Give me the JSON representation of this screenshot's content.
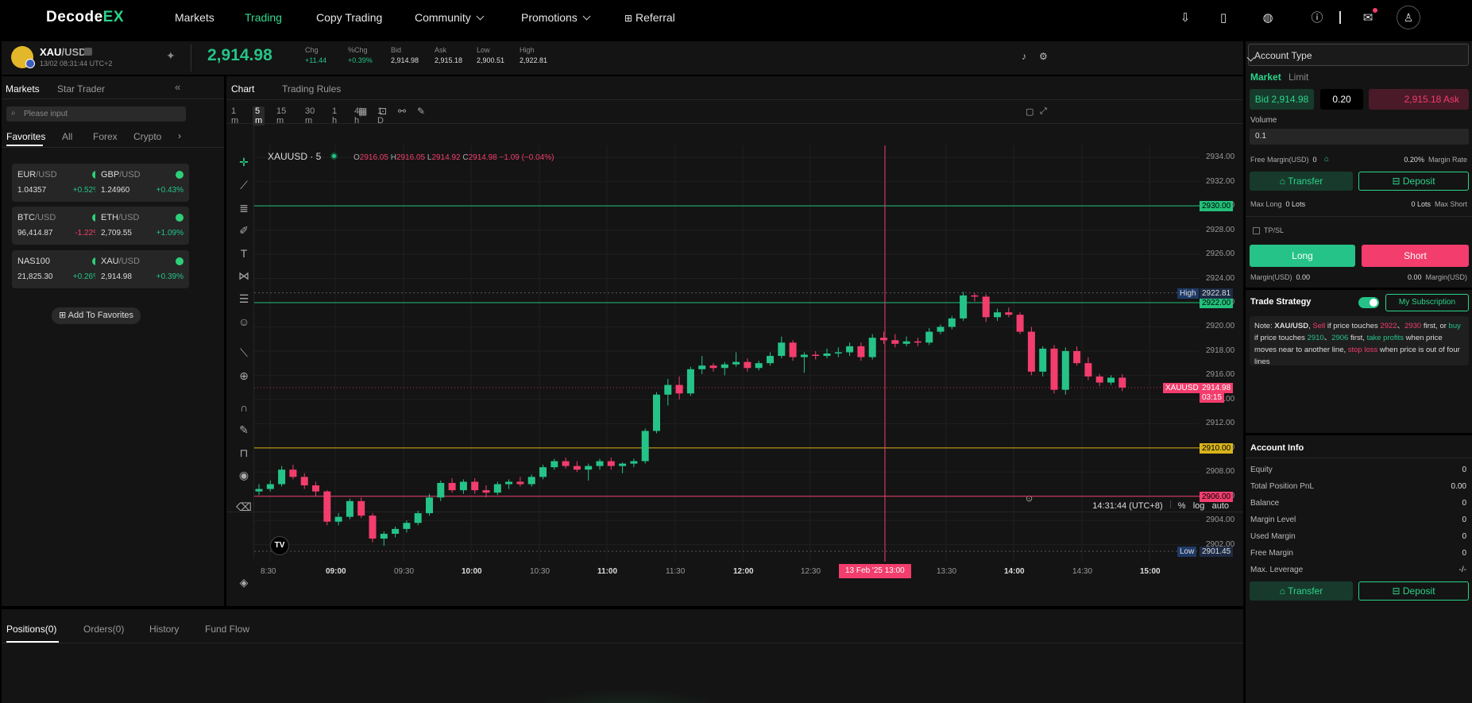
{
  "brand": {
    "name": "DecodeEX",
    "logo_main": "Decode",
    "logo_accent": "EX"
  },
  "nav": {
    "markets": "Markets",
    "trading": "Trading",
    "copy_trading": "Copy Trading",
    "community": "Community",
    "promotions": "Promotions",
    "referral": "Referral"
  },
  "ticker": {
    "symbol_base": "XAU",
    "symbol_quote": "/USD",
    "datetime": "13/02 08:31:44",
    "tz": "UTC+2",
    "price": "2,914.98",
    "chg_label": "Chg",
    "chg_value": "+11.44",
    "pchg_label": "%Chg",
    "pchg_value": "+0.39%",
    "bid_label": "Bid",
    "bid_value": "2,914.98",
    "ask_label": "Ask",
    "ask_value": "2,915.18",
    "low_label": "Low",
    "low_value": "2,900.51",
    "high_label": "High",
    "high_value": "2,922.81"
  },
  "markets": {
    "tab_markets": "Markets",
    "tab_star": "Star Trader",
    "search_placeholder": "Please input",
    "filters": [
      "Favorites",
      "All",
      "Forex",
      "Crypto"
    ],
    "cards": [
      {
        "base": "EUR",
        "quote": "/USD",
        "price": "1.04357",
        "change": "+0.52%",
        "up": true
      },
      {
        "base": "GBP",
        "quote": "/USD",
        "price": "1.24960",
        "change": "+0.43%",
        "up": true
      },
      {
        "base": "BTC",
        "quote": "/USD",
        "price": "96,414.87",
        "change": "-1.22%",
        "up": false
      },
      {
        "base": "ETH",
        "quote": "/USD",
        "price": "2,709.55",
        "change": "+1.09%",
        "up": true
      },
      {
        "base": "NAS100",
        "quote": "",
        "price": "21,825.30",
        "change": "+0.26%",
        "up": true
      },
      {
        "base": "XAU",
        "quote": "/USD",
        "price": "2,914.98",
        "change": "+0.39%",
        "up": true
      }
    ],
    "add_favorites": "Add To Favorites"
  },
  "chart": {
    "tab_chart": "Chart",
    "tab_rules": "Trading Rules",
    "intervals": [
      "1 m",
      "5 m",
      "15 m",
      "30 m",
      "1 h",
      "4 h",
      "1 D"
    ],
    "active_interval": "5 m",
    "legend_symbol": "XAUUSD · 5",
    "ohlc": {
      "o": "2916.05",
      "h": "2916.05",
      "l": "2914.92",
      "c": "2914.98",
      "chg": "−1.09 (−0.04%)"
    },
    "price_axis": [
      "2934.00",
      "2932.00",
      "2930.00",
      "2928.00",
      "2926.00",
      "2924.00",
      "2922.00",
      "2920.00",
      "2918.00",
      "2916.00",
      "2914.00",
      "2912.00",
      "2910.00",
      "2908.00",
      "2906.00",
      "2904.00",
      "2902.00"
    ],
    "time_axis": [
      {
        "t": "8:30",
        "bold": false
      },
      {
        "t": "09:00",
        "bold": true
      },
      {
        "t": "09:30",
        "bold": false
      },
      {
        "t": "10:00",
        "bold": true
      },
      {
        "t": "10:30",
        "bold": false
      },
      {
        "t": "11:00",
        "bold": true
      },
      {
        "t": "11:30",
        "bold": false
      },
      {
        "t": "12:00",
        "bold": true
      },
      {
        "t": "12:30",
        "bold": false
      },
      {
        "t": "13:30",
        "bold": false
      },
      {
        "t": "14:00",
        "bold": true
      },
      {
        "t": "14:30",
        "bold": false
      },
      {
        "t": "15:00",
        "bold": true
      }
    ],
    "crosshair_time": "13 Feb '25   13:00",
    "h_lines": [
      {
        "price": "2930.00",
        "color": "#22c07a"
      },
      {
        "price": "2922.00",
        "color": "#22c07a"
      },
      {
        "price": "2910.00",
        "color": "#d8b41c"
      },
      {
        "price": "2906.00",
        "color": "#f23d6d"
      }
    ],
    "high_tag": "High",
    "high_value": "2922.81",
    "low_tag": "Low",
    "low_value": "2901.45",
    "last_tag": "XAUUSD",
    "last_value": "2914.98",
    "last_countdown": "03:15",
    "clock": "14:31:44 (UTC+8)",
    "opt_pct": "%",
    "opt_log": "log",
    "opt_auto": "auto",
    "candles": [
      [
        2906.4,
        2907.0,
        2906.1,
        2906.6
      ],
      [
        2906.6,
        2907.3,
        2906.4,
        2907.0
      ],
      [
        2907.0,
        2908.5,
        2906.8,
        2908.2
      ],
      [
        2908.2,
        2908.6,
        2907.4,
        2907.6
      ],
      [
        2907.6,
        2907.9,
        2906.6,
        2906.9
      ],
      [
        2906.9,
        2907.2,
        2906.0,
        2906.4
      ],
      [
        2906.4,
        2906.5,
        2903.6,
        2903.9
      ],
      [
        2903.9,
        2904.6,
        2903.6,
        2904.3
      ],
      [
        2904.3,
        2905.8,
        2904.1,
        2905.6
      ],
      [
        2905.6,
        2905.9,
        2904.2,
        2904.4
      ],
      [
        2904.4,
        2904.6,
        2902.2,
        2902.5
      ],
      [
        2902.5,
        2903.1,
        2901.9,
        2902.9
      ],
      [
        2902.9,
        2903.5,
        2902.6,
        2903.3
      ],
      [
        2903.3,
        2904.0,
        2903.0,
        2903.8
      ],
      [
        2903.8,
        2904.8,
        2903.6,
        2904.6
      ],
      [
        2904.6,
        2906.2,
        2904.4,
        2905.9
      ],
      [
        2905.9,
        2907.3,
        2905.6,
        2907.1
      ],
      [
        2907.1,
        2907.5,
        2906.3,
        2906.5
      ],
      [
        2906.5,
        2907.4,
        2906.2,
        2907.2
      ],
      [
        2907.2,
        2907.5,
        2906.2,
        2906.5
      ],
      [
        2906.5,
        2906.9,
        2905.9,
        2906.3
      ],
      [
        2906.3,
        2907.2,
        2906.1,
        2907.0
      ],
      [
        2907.0,
        2907.4,
        2906.6,
        2907.2
      ],
      [
        2907.2,
        2907.6,
        2906.8,
        2907.0
      ],
      [
        2907.0,
        2907.8,
        2906.8,
        2907.6
      ],
      [
        2907.6,
        2908.6,
        2907.4,
        2908.4
      ],
      [
        2908.4,
        2909.1,
        2908.2,
        2908.9
      ],
      [
        2908.9,
        2909.2,
        2908.3,
        2908.5
      ],
      [
        2908.5,
        2908.9,
        2908.0,
        2908.2
      ],
      [
        2908.2,
        2908.7,
        2907.3,
        2908.5
      ],
      [
        2908.5,
        2909.1,
        2908.2,
        2908.9
      ],
      [
        2908.9,
        2909.2,
        2908.2,
        2908.5
      ],
      [
        2908.5,
        2908.8,
        2907.9,
        2908.7
      ],
      [
        2908.7,
        2909.1,
        2908.4,
        2908.9
      ],
      [
        2908.9,
        2911.6,
        2908.7,
        2911.4
      ],
      [
        2911.4,
        2914.6,
        2911.2,
        2914.4
      ],
      [
        2914.4,
        2915.7,
        2913.5,
        2915.2
      ],
      [
        2915.2,
        2915.9,
        2914.0,
        2914.5
      ],
      [
        2914.5,
        2916.7,
        2914.3,
        2916.5
      ],
      [
        2916.5,
        2917.6,
        2916.1,
        2916.8
      ],
      [
        2916.8,
        2917.0,
        2916.3,
        2916.6
      ],
      [
        2916.6,
        2917.1,
        2916.0,
        2916.9
      ],
      [
        2916.9,
        2917.9,
        2916.7,
        2917.1
      ],
      [
        2917.1,
        2917.4,
        2916.3,
        2916.6
      ],
      [
        2916.6,
        2917.2,
        2916.4,
        2917.0
      ],
      [
        2917.0,
        2917.9,
        2916.8,
        2917.6
      ],
      [
        2917.6,
        2919.2,
        2917.4,
        2918.7
      ],
      [
        2918.7,
        2918.9,
        2917.2,
        2917.5
      ],
      [
        2917.5,
        2917.9,
        2916.2,
        2917.7
      ],
      [
        2917.7,
        2918.0,
        2917.3,
        2917.6
      ],
      [
        2917.6,
        2918.2,
        2917.4,
        2917.8
      ],
      [
        2917.8,
        2918.3,
        2917.5,
        2917.9
      ],
      [
        2917.9,
        2918.7,
        2917.6,
        2918.4
      ],
      [
        2918.4,
        2918.7,
        2917.2,
        2917.5
      ],
      [
        2917.5,
        2919.4,
        2917.3,
        2919.1
      ],
      [
        2919.1,
        2919.6,
        2918.6,
        2918.9
      ],
      [
        2918.9,
        2919.4,
        2918.3,
        2918.6
      ],
      [
        2918.6,
        2919.2,
        2918.4,
        2918.8
      ],
      [
        2918.8,
        2919.1,
        2918.4,
        2918.7
      ],
      [
        2918.7,
        2919.9,
        2918.5,
        2919.6
      ],
      [
        2919.6,
        2920.2,
        2919.4,
        2920.0
      ],
      [
        2920.0,
        2920.9,
        2919.8,
        2920.7
      ],
      [
        2920.7,
        2922.9,
        2920.5,
        2922.6
      ],
      [
        2922.6,
        2922.8,
        2922.1,
        2922.5
      ],
      [
        2922.5,
        2922.7,
        2920.4,
        2920.8
      ],
      [
        2920.8,
        2921.5,
        2920.5,
        2921.2
      ],
      [
        2921.2,
        2921.6,
        2920.8,
        2921.0
      ],
      [
        2921.0,
        2921.2,
        2919.4,
        2919.6
      ],
      [
        2919.6,
        2920.0,
        2916.0,
        2916.3
      ],
      [
        2916.3,
        2918.4,
        2915.9,
        2918.2
      ],
      [
        2918.2,
        2918.5,
        2914.5,
        2914.8
      ],
      [
        2914.8,
        2918.3,
        2914.4,
        2918.0
      ],
      [
        2918.0,
        2918.4,
        2916.8,
        2917.0
      ],
      [
        2917.0,
        2917.5,
        2915.6,
        2915.9
      ],
      [
        2915.9,
        2916.1,
        2915.1,
        2915.4
      ],
      [
        2915.4,
        2916.0,
        2915.2,
        2915.8
      ],
      [
        2915.8,
        2916.1,
        2914.7,
        2914.98
      ]
    ]
  },
  "positions": {
    "tabs": [
      "Positions(0)",
      "Orders(0)",
      "History",
      "Fund Flow"
    ]
  },
  "order": {
    "account_type": "Account Type",
    "tab_market": "Market",
    "tab_limit": "Limit",
    "bid_btn": "Bid 2,914.98",
    "qty": "0.20",
    "ask_btn": "2,915.18 Ask",
    "volume_label": "Volume",
    "volume_value": "0.1",
    "free_margin_label": "Free Margin(USD)",
    "free_margin_value": "0",
    "margin_rate_value": "0.20%",
    "margin_rate_label": "Margin Rate",
    "transfer": "Transfer",
    "deposit": "Deposit",
    "max_long_label": "Max Long",
    "max_long_value": "0 Lots",
    "max_short_value": "0 Lots",
    "max_short_label": "Max Short",
    "tpsl": "TP/SL",
    "long": "Long",
    "short": "Short",
    "margin_l_label": "Margin(USD)",
    "margin_l_value": "0.00",
    "margin_r_value": "0.00",
    "margin_r_label": "Margin(USD)",
    "strategy_title": "Trade Strategy",
    "subscription": "My Subscription",
    "note": {
      "p1": "Note: ",
      "sym": "XAU/USD",
      "p2": ", ",
      "sell": "Sell",
      "p3": " if price touches ",
      "s1": "2922",
      "sep1": "、",
      "s2": "2930",
      "p4": " first, or ",
      "buy": "buy",
      "p5": " if price touches ",
      "b1": "2910",
      "sep2": "、",
      "b2": "2906",
      "p6": " first, ",
      "tp": "take profits",
      "p7": " when price moves near to another line, ",
      "sl": "stop loss",
      "p8": " when price is out of four lines"
    }
  },
  "account": {
    "title": "Account Info",
    "rows": [
      {
        "label": "Equity",
        "value": "0"
      },
      {
        "label": "Total Position PnL",
        "value": "0.00"
      },
      {
        "label": "Balance",
        "value": "0"
      },
      {
        "label": "Margin Level",
        "value": "0"
      },
      {
        "label": "Used Margin",
        "value": "0"
      },
      {
        "label": "Free Margin",
        "value": "0"
      },
      {
        "label": "Max. Leverage",
        "value": "-/-"
      }
    ],
    "transfer": "Transfer",
    "deposit": "Deposit"
  }
}
